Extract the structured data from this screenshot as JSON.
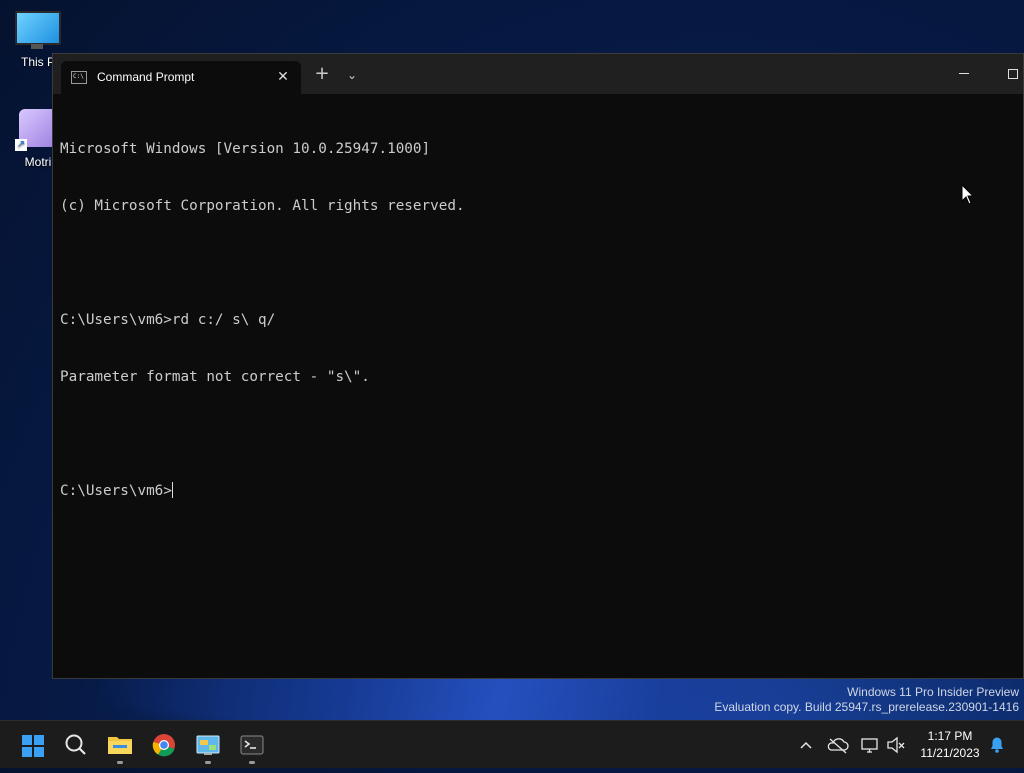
{
  "desktop": {
    "icons": [
      {
        "label": "This P",
        "icon": "this-pc-icon"
      },
      {
        "label": "Motri",
        "icon": "motrix-icon"
      }
    ]
  },
  "window": {
    "tab_title": "Command Prompt",
    "tab_icon": "cmd-icon",
    "new_tab_icon": "plus-icon",
    "dropdown_icon": "chevron-down-icon",
    "minimize_icon": "minimize-icon",
    "maximize_icon": "maximize-icon",
    "close_tab_icon": "close-icon"
  },
  "console": {
    "lines": [
      "Microsoft Windows [Version 10.0.25947.1000]",
      "(c) Microsoft Corporation. All rights reserved.",
      "",
      "C:\\Users\\vm6>rd c:/ s\\ q/",
      "Parameter format not correct - \"s\\\".",
      ""
    ],
    "prompt": "C:\\Users\\vm6>"
  },
  "watermark": {
    "line1": "Windows 11 Pro Insider Preview",
    "line2": "Evaluation copy. Build 25947.rs_prerelease.230901-1416"
  },
  "taskbar": {
    "apps": [
      {
        "name": "start",
        "icon": "windows-start-icon"
      },
      {
        "name": "search",
        "icon": "search-icon"
      },
      {
        "name": "file-explorer",
        "icon": "folder-icon"
      },
      {
        "name": "chrome",
        "icon": "chrome-icon"
      },
      {
        "name": "control-panel",
        "icon": "control-panel-icon"
      },
      {
        "name": "terminal",
        "icon": "terminal-icon"
      }
    ],
    "tray": {
      "chevron_icon": "chevron-up-icon",
      "onedrive_icon": "cloud-off-icon",
      "network_icon": "network-icon",
      "volume_icon": "volume-muted-icon",
      "notification_icon": "bell-icon"
    },
    "time": "1:17 PM",
    "date": "11/21/2023"
  },
  "colors": {
    "console_bg": "#0c0c0c",
    "console_text": "#cccccc",
    "titlebar": "#202020",
    "taskbar": "#1c1c1c",
    "accent": "#3aa0f3"
  }
}
